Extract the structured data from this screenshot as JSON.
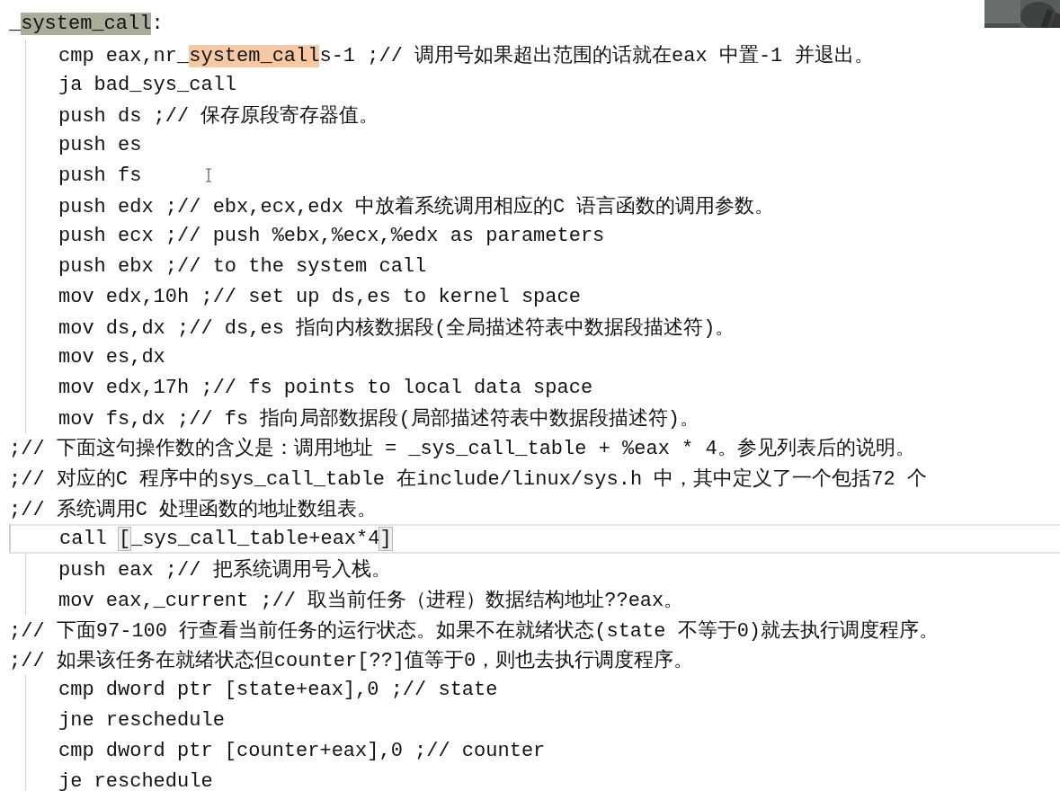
{
  "lines": [
    {
      "kind": "label",
      "current": false,
      "parts": [
        {
          "text": "_"
        },
        {
          "text": "system_call",
          "highlight": true,
          "color": "#a9ad9a"
        },
        {
          "text": ":"
        }
      ]
    },
    {
      "kind": "code",
      "current": false,
      "parts": [
        {
          "text": "cmp eax,nr_"
        },
        {
          "text": "system_call",
          "highlight": true,
          "color": "#f6c8a4"
        },
        {
          "text": "s-1 ;// 调用号如果超出范围的话就在eax 中置-1 并退出。"
        }
      ]
    },
    {
      "kind": "code",
      "current": false,
      "parts": [
        {
          "text": "ja bad_sys_call"
        }
      ]
    },
    {
      "kind": "code",
      "current": false,
      "parts": [
        {
          "text": "push ds ;// 保存原段寄存器值。"
        }
      ]
    },
    {
      "kind": "code",
      "current": false,
      "parts": [
        {
          "text": "push es"
        }
      ]
    },
    {
      "kind": "code",
      "current": false,
      "cursor": true,
      "parts": [
        {
          "text": "push fs"
        }
      ]
    },
    {
      "kind": "code",
      "current": false,
      "parts": [
        {
          "text": "push edx ;// ebx,ecx,edx 中放着系统调用相应的C 语言函数的调用参数。"
        }
      ]
    },
    {
      "kind": "code",
      "current": false,
      "parts": [
        {
          "text": "push ecx ;// push %ebx,%ecx,%edx as parameters"
        }
      ]
    },
    {
      "kind": "code",
      "current": false,
      "parts": [
        {
          "text": "push ebx ;// to the system call"
        }
      ]
    },
    {
      "kind": "code",
      "current": false,
      "parts": [
        {
          "text": "mov edx,10h ;// set up ds,es to kernel space"
        }
      ]
    },
    {
      "kind": "code",
      "current": false,
      "parts": [
        {
          "text": "mov ds,dx ;// ds,es 指向内核数据段(全局描述符表中数据段描述符)。"
        }
      ]
    },
    {
      "kind": "code",
      "current": false,
      "parts": [
        {
          "text": "mov es,dx"
        }
      ]
    },
    {
      "kind": "code",
      "current": false,
      "parts": [
        {
          "text": "mov edx,17h ;// fs points to local data space"
        }
      ]
    },
    {
      "kind": "code",
      "current": false,
      "parts": [
        {
          "text": "mov fs,dx ;// fs 指向局部数据段(局部描述符表中数据段描述符)。"
        }
      ]
    },
    {
      "kind": "comment",
      "current": false,
      "parts": [
        {
          "text": ";// 下面这句操作数的含义是：调用地址 = _sys_call_table + %eax * 4。参见列表后的说明。"
        }
      ]
    },
    {
      "kind": "comment",
      "current": false,
      "parts": [
        {
          "text": ";// 对应的C 程序中的sys_call_table 在include/linux/sys.h 中，其中定义了一个包括72 个"
        }
      ]
    },
    {
      "kind": "comment",
      "current": false,
      "parts": [
        {
          "text": ";// 系统调用C 处理函数的地址数组表。"
        }
      ]
    },
    {
      "kind": "code",
      "current": true,
      "parts": [
        {
          "text": "call "
        },
        {
          "text": "[",
          "boxed": true
        },
        {
          "text": "_sys_call_table+eax*4"
        },
        {
          "text": "]",
          "boxed": true
        }
      ]
    },
    {
      "kind": "code",
      "current": false,
      "parts": [
        {
          "text": "push eax ;// 把系统调用号入栈。"
        }
      ]
    },
    {
      "kind": "code",
      "current": false,
      "parts": [
        {
          "text": "mov eax,_current ;// 取当前任务（进程）数据结构地址??eax。"
        }
      ]
    },
    {
      "kind": "comment",
      "current": false,
      "parts": [
        {
          "text": ";// 下面97-100 行查看当前任务的运行状态。如果不在就绪状态(state 不等于0)就去执行调度程序。"
        }
      ]
    },
    {
      "kind": "comment",
      "current": false,
      "parts": [
        {
          "text": ";// 如果该任务在就绪状态但counter[??]值等于0，则也去执行调度程序。"
        }
      ]
    },
    {
      "kind": "code",
      "current": false,
      "parts": [
        {
          "text": "cmp dword ptr [state+eax],0 ;// state"
        }
      ]
    },
    {
      "kind": "code",
      "current": false,
      "parts": [
        {
          "text": "jne reschedule"
        }
      ]
    },
    {
      "kind": "code",
      "current": false,
      "parts": [
        {
          "text": "cmp dword ptr [counter+eax],0 ;// counter"
        }
      ]
    },
    {
      "kind": "code",
      "current": false,
      "parts": [
        {
          "text": "je reschedule"
        }
      ]
    }
  ]
}
